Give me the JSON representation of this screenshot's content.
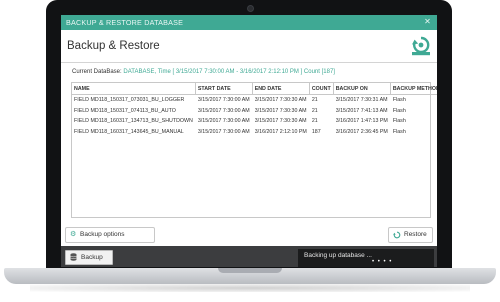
{
  "window": {
    "title": "BACKUP & RESTORE DATABASE",
    "close_glyph": "✕"
  },
  "header": {
    "heading": "Backup & Restore",
    "icon": "restore-icon"
  },
  "current_db": {
    "label": "Current DataBase:",
    "value": "DATABASE, Time [ 3/15/2017 7:30:00 AM - 3/16/2017 2:12:10 PM ] Count [187]"
  },
  "table": {
    "columns": [
      "NAME",
      "START DATE",
      "END DATE",
      "COUNT",
      "BACKUP ON",
      "BACKUP METHOD"
    ],
    "rows": [
      [
        "FIELD MD118_150317_073031_BU_LOGGER",
        "3/15/2017 7:30:00 AM",
        "3/15/2017 7:30:30 AM",
        "21",
        "3/15/2017 7:30:31 AM",
        "Flash"
      ],
      [
        "FIELD MD118_150317_074113_BU_AUTO",
        "3/15/2017 7:30:00 AM",
        "3/15/2017 7:30:30 AM",
        "21",
        "3/15/2017 7:41:13 AM",
        "Flash"
      ],
      [
        "FIELD MD118_160317_134713_BU_SHUTDOWN",
        "3/15/2017 7:30:00 AM",
        "3/15/2017 7:30:30 AM",
        "21",
        "3/16/2017 1:47:13 PM",
        "Flash"
      ],
      [
        "FIELD MD118_160317_143645_BU_MANUAL",
        "3/15/2017 7:30:00 AM",
        "3/16/2017 2:12:10 PM",
        "187",
        "3/16/2017 2:36:45 PM",
        "Flash"
      ]
    ]
  },
  "buttons": {
    "backup_options": "Backup options",
    "restore": "Restore",
    "backup": "Backup"
  },
  "status": {
    "message": "Backing up database ...",
    "dots": "• • • •"
  },
  "colors": {
    "accent": "#3fa994",
    "bottom_bar": "#3c3d3f",
    "laptop_frame": "#111214"
  }
}
